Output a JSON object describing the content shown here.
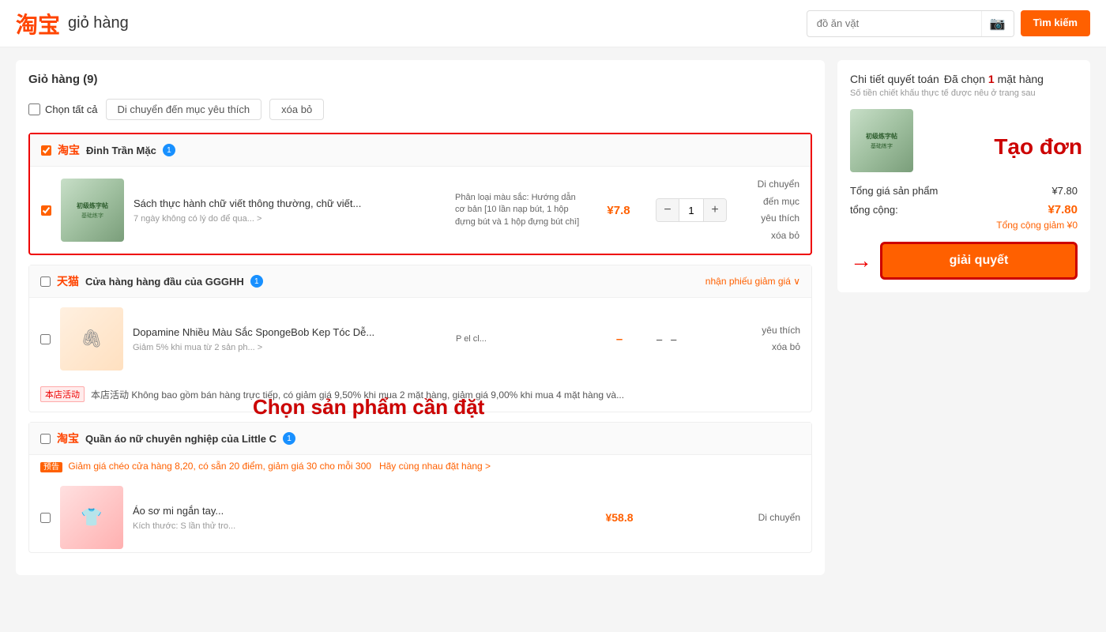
{
  "header": {
    "logo": "淘宝",
    "title": "giỏ hàng",
    "search_placeholder": "đồ ăn vặt",
    "search_btn": "Tìm kiếm"
  },
  "cart": {
    "title": "Giỏ hàng",
    "count": "(9)",
    "select_all": "Chọn tất cả",
    "move_to_fav": "Di chuyển đến mục yêu thích",
    "delete": "xóa bỏ"
  },
  "shops": [
    {
      "logo": "淘宝",
      "name": "Đinh Trần Mặc",
      "badge": "1",
      "selected": true,
      "products": [
        {
          "name": "Sách thực hành chữ viết thông thường, chữ viết...",
          "subtext": "7 ngày không có lý do để qua... >",
          "variant": "Phân loại màu sắc: Hướng dẫn cơ bản [10 lần nạp bút, 1 hộp đựng bút và 1 hộp đựng bút chì]",
          "price": "¥7.8",
          "quantity": 1,
          "checked": true,
          "actions": "Di chuyển đến mục yêu thích\nxóa bỏ"
        }
      ]
    },
    {
      "logo": "天猫",
      "name": "Cửa hàng hàng đầu của GGGHH",
      "badge": "1",
      "selected": false,
      "coupon": "nhận phiếu giảm giá ∨",
      "products": [
        {
          "name": "Dopamine Nhiều Màu Sắc SpongeBob Kep Tóc Dễ...",
          "subtext": "Giảm 5% khi mua từ 2 sản ph... >",
          "variant": "P el cl...",
          "price": "–",
          "quantity": null,
          "checked": false,
          "actions": "yêu thích\nxóa bỏ"
        }
      ],
      "discount_text": "本店活动  Không bao gồm bán hàng trực tiếp, có giảm giá 9,50% khi mua 2 mặt hàng, giảm giá 9,00% khi mua 4 mặt hàng và..."
    },
    {
      "logo": "淘宝",
      "name": "Quần áo nữ chuyên nghiệp của Little C",
      "badge": "1",
      "selected": false,
      "promo_text": "预告  Giảm giá chéo cửa hàng 8,20, có sẵn 20 điểm, giảm giá 30 cho mỗi 300    Hãy cùng nhau đặt hàng >",
      "products": [
        {
          "name": "Áo sơ mi ngắn tay...",
          "subtext": "Kích thước: S lần thử tro...",
          "price": "¥58.8",
          "quantity": null,
          "checked": false,
          "actions": "Di chuyển"
        }
      ]
    }
  ],
  "checkout": {
    "header": "Chi tiết quyết toán",
    "selected_text": "Đã chọn",
    "selected_count": "1",
    "selected_unit": "mặt hàng",
    "subtitle": "Số tiền chiết khấu thực tế được nêu ở trang sau",
    "total_product_label": "Tổng giá sản phẩm",
    "total_product_value": "¥7.80",
    "total_label": "tổng cộng:",
    "total_value": "¥7.80",
    "total_discount_label": "Tổng cộng giảm",
    "total_discount_value": "¥0",
    "btn_label": "giải quyết"
  },
  "annotations": {
    "chon_tat": "Chọn tất",
    "chon_san_pham": "Chọn sản phẩm cần đặt",
    "tao_don": "Tạo đơn"
  }
}
